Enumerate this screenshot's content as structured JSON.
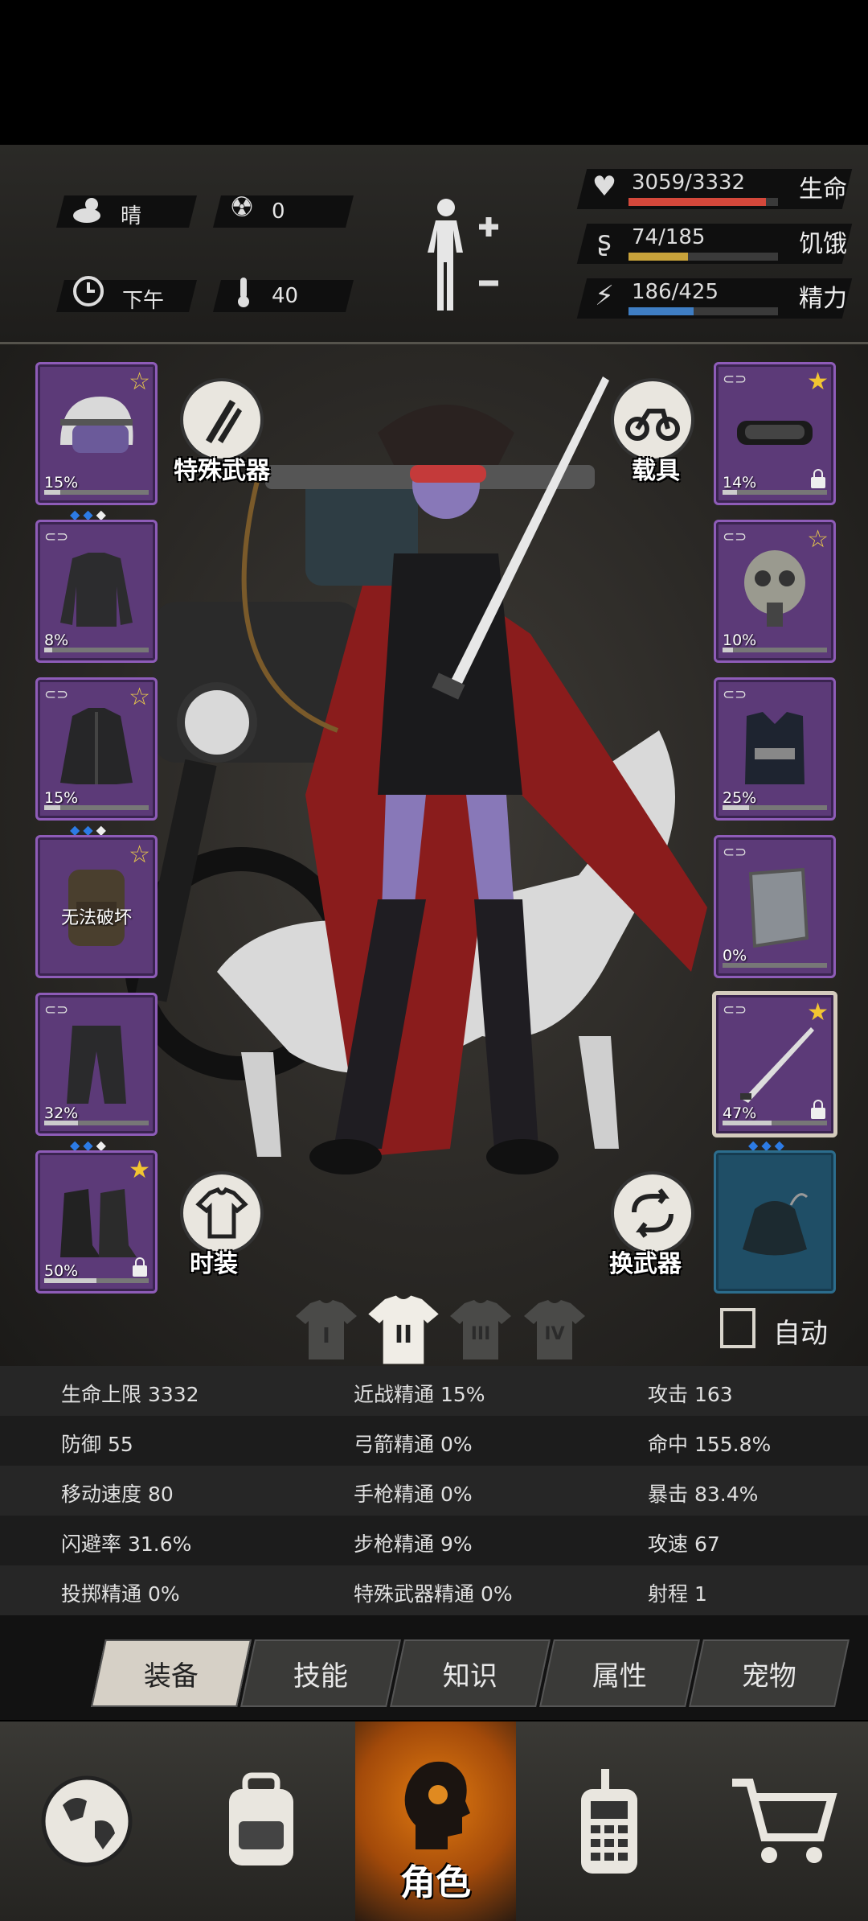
{
  "status": {
    "weather": "晴",
    "radiation": "0",
    "time_of_day": "下午",
    "temperature": "40",
    "health": {
      "text": "3059/3332",
      "label": "生命",
      "value": 3059,
      "max": 3332,
      "color": "#d4483b"
    },
    "hunger": {
      "text": "74/185",
      "label": "饥饿",
      "value": 74,
      "max": 185,
      "color": "#c8a23a"
    },
    "energy": {
      "text": "186/425",
      "label": "精力",
      "value": 186,
      "max": 425,
      "color": "#3f7ec4"
    }
  },
  "left_slots": [
    {
      "name": "helmet",
      "pct": "15%",
      "star": true,
      "gems": [
        "b",
        "b",
        "w"
      ],
      "durability": 0.15
    },
    {
      "name": "shirt",
      "pct": "8%",
      "star": false,
      "durability": 0.08
    },
    {
      "name": "jacket",
      "pct": "15%",
      "star": true,
      "gems": [
        "b",
        "b",
        "w"
      ],
      "durability": 0.15
    },
    {
      "name": "backpack",
      "note": "无法破坏",
      "star": true
    },
    {
      "name": "pants",
      "pct": "32%",
      "star": false,
      "gems": [
        "b",
        "b",
        "w"
      ],
      "durability": 0.32
    },
    {
      "name": "boots",
      "pct": "50%",
      "star": true,
      "lock": true,
      "durability": 0.5
    }
  ],
  "right_slots": [
    {
      "name": "goggles",
      "pct": "14%",
      "star": true,
      "star_filled": true,
      "lock": true,
      "durability": 0.14
    },
    {
      "name": "gas-mask",
      "pct": "10%",
      "star": true,
      "durability": 0.1
    },
    {
      "name": "vest",
      "pct": "25%",
      "star": false,
      "durability": 0.25
    },
    {
      "name": "shield",
      "pct": "0%",
      "star": false,
      "durability": 0
    },
    {
      "name": "katana",
      "pct": "47%",
      "star": true,
      "star_filled": true,
      "lock": true,
      "gems": [
        "b",
        "b",
        "b"
      ],
      "durability": 0.47
    },
    {
      "name": "pouch"
    }
  ],
  "buttons": {
    "special_weapon": "特殊武器",
    "vehicle": "载具",
    "fashion": "时装",
    "swap_weapon": "换武器",
    "auto": "自动"
  },
  "loadouts": [
    "I",
    "II",
    "III",
    "IV"
  ],
  "stats": [
    [
      "生命上限 3332",
      "近战精通 15%",
      "攻击 163"
    ],
    [
      "防御 55",
      "弓箭精通 0%",
      "命中 155.8%"
    ],
    [
      "移动速度 80",
      "手枪精通 0%",
      "暴击 83.4%"
    ],
    [
      "闪避率 31.6%",
      "步枪精通 9%",
      "攻速 67"
    ],
    [
      "投掷精通 0%",
      "特殊武器精通 0%",
      "射程 1"
    ]
  ],
  "tabs": [
    "装备",
    "技能",
    "知识",
    "属性",
    "宠物"
  ],
  "nav": {
    "active_label": "角色"
  }
}
